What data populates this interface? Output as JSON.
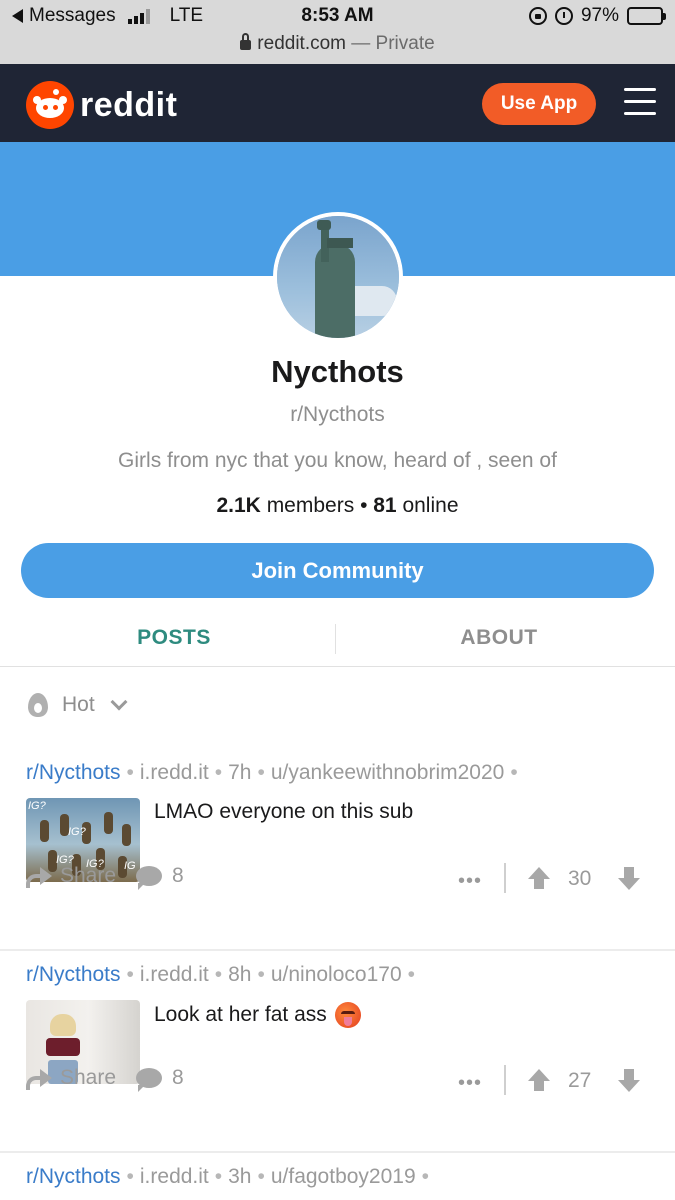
{
  "status_bar": {
    "back_app": "Messages",
    "network": "LTE",
    "time": "8:53 AM",
    "battery": "97%",
    "battery_level": 0.97
  },
  "url_bar": {
    "domain": "reddit.com",
    "mode": "— Private"
  },
  "header": {
    "logo_text": "reddit",
    "use_app_label": "Use App",
    "accent": "#ff4500",
    "background": "#1f2535"
  },
  "community": {
    "banner_color": "#4a9ee5",
    "name": "Nycthots",
    "handle": "r/Nycthots",
    "description": "Girls from nyc that you know, heard of , seen of",
    "members_count": "2.1K",
    "members_label": "members",
    "online_count": "81",
    "online_label": "online",
    "join_label": "Join Community"
  },
  "tabs": [
    {
      "label": "POSTS",
      "active": true
    },
    {
      "label": "ABOUT",
      "active": false
    }
  ],
  "sort": {
    "label": "Hot"
  },
  "posts": [
    {
      "subreddit": "r/Nycthots",
      "domain": "i.redd.it",
      "age": "7h",
      "author": "u/yankeewithnobrim2020",
      "title": "LMAO everyone on this sub",
      "share_label": "Share",
      "comments": "8",
      "score": "30"
    },
    {
      "subreddit": "r/Nycthots",
      "domain": "i.redd.it",
      "age": "8h",
      "author": "u/ninoloco170",
      "title": "Look at her fat ass",
      "share_label": "Share",
      "comments": "8",
      "score": "27"
    },
    {
      "subreddit": "r/Nycthots",
      "domain": "i.redd.it",
      "age": "3h",
      "author": "u/fagotboy2019"
    }
  ],
  "thumb_labels": [
    "IG?",
    "IG?",
    "IG?",
    "IG",
    "IG?"
  ]
}
